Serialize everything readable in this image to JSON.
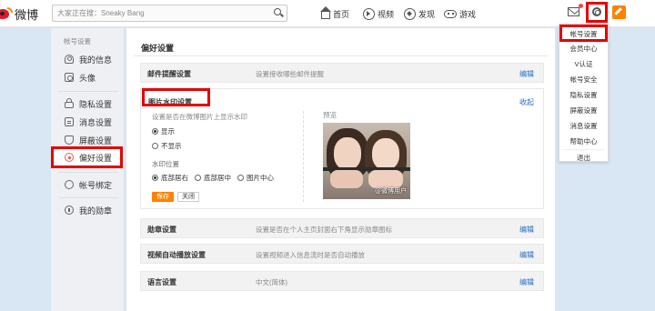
{
  "header": {
    "logo_text": "微博",
    "search_placeholder": "大家正在搜：Sneaky Bang",
    "nav": [
      {
        "label": "首页",
        "icon": "home-icon"
      },
      {
        "label": "视频",
        "icon": "video-icon"
      },
      {
        "label": "发现",
        "icon": "discover-icon"
      },
      {
        "label": "游戏",
        "icon": "game-icon"
      }
    ]
  },
  "sidebar": {
    "heading": "帐号设置",
    "items": [
      {
        "label": "我的信息",
        "icon": "person-icon"
      },
      {
        "label": "头像",
        "icon": "avatar-icon"
      },
      {
        "label": "隐私设置",
        "icon": "lock-icon"
      },
      {
        "label": "消息设置",
        "icon": "message-icon"
      },
      {
        "label": "屏蔽设置",
        "icon": "shield-icon"
      },
      {
        "label": "偏好设置",
        "icon": "heart-icon"
      },
      {
        "label": "帐号绑定",
        "icon": "link-icon"
      },
      {
        "label": "我的勋章",
        "icon": "medal-icon"
      }
    ],
    "active_index": 5
  },
  "main": {
    "title": "偏好设置",
    "edit_label": "编辑",
    "email_row": {
      "name": "邮件提醒设置",
      "desc": "设置接收哪些邮件提醒"
    },
    "watermark": {
      "title": "图片水印设置",
      "collapse_label": "收起",
      "question": "设置是否在微博图片上显示水印",
      "show_label": "显示",
      "hide_label": "不显示",
      "show_selected": true,
      "position_label": "水印位置",
      "positions": [
        "底部居右",
        "底部居中",
        "图片中心"
      ],
      "position_selected": 0,
      "save_label": "保存",
      "close_label": "关闭",
      "preview_label": "预览",
      "preview_watermark": "@微博用户"
    },
    "rows": [
      {
        "name": "勋章设置",
        "desc": "设置是否在个人主页封面右下角显示勋章图标"
      },
      {
        "name": "视频自动播放设置",
        "desc": "设置视频进入信息流时是否自动播放"
      },
      {
        "name": "语言设置",
        "desc": "中文(简体)"
      }
    ]
  },
  "dropdown": {
    "items": [
      "帐号设置",
      "会员中心",
      "V认证",
      "帐号安全",
      "隐私设置",
      "屏蔽设置",
      "消息设置",
      "帮助中心",
      "退出"
    ]
  },
  "colors": {
    "highlight": "#e60000",
    "link": "#2a6ebb",
    "accent": "#ff8200",
    "page_bg": "#d9e6f3"
  }
}
